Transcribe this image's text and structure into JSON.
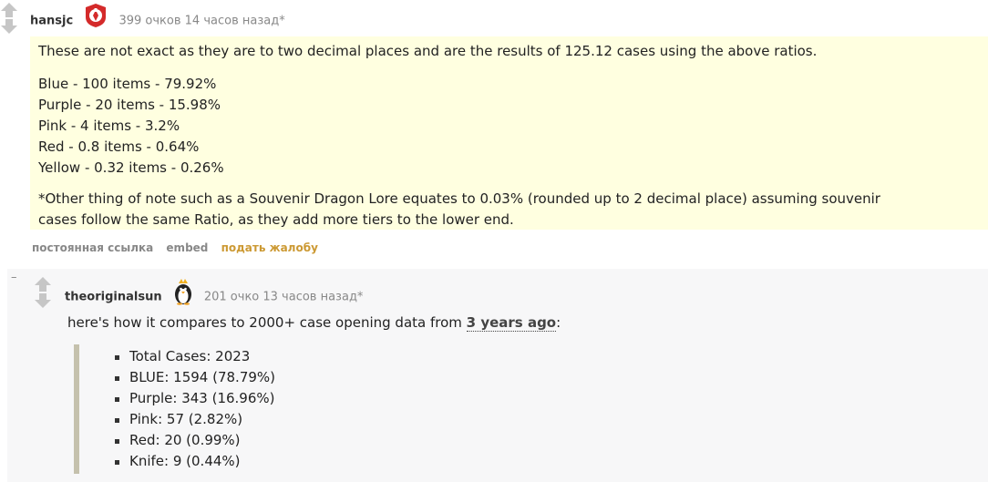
{
  "comment": {
    "author": "hansjc",
    "flair_icon": "gambit-logo-icon",
    "score_time": "399 очков 14 часов назад*",
    "paragraphs": [
      "These are not exact as they are to two decimal places and are the results of 125.12 cases using the above ratios."
    ],
    "lines": [
      "Blue - 100 items - 79.92%",
      "Purple - 20 items - 15.98%",
      "Pink - 4 items - 3.2%",
      "Red - 0.8 items - 0.64%",
      "Yellow - 0.32 items - 0.26%"
    ],
    "note_line1": "*Other thing of note such as a Souvenir Dragon Lore equates to 0.03% (rounded up to 2 decimal place) assuming souvenir",
    "note_line2": "cases follow the same Ratio, as they add more tiers to the lower end.",
    "highlight_color": "#ffffe0",
    "buttons": {
      "permalink": "постоянная ссылка",
      "embed": "embed",
      "report": "подать жалобу"
    }
  },
  "reply": {
    "collapse": "–",
    "author": "theoriginalsun",
    "flair_icon": "penguin-icon",
    "score_time": "201 очко 13 часов назад*",
    "text_before": "here's how it compares to 2000+ case opening data from ",
    "link_text": "3 years ago",
    "text_after": ":",
    "list": [
      "Total Cases: 2023",
      "BLUE: 1594 (78.79%)",
      "Purple: 343 (16.96%)",
      "Pink: 57 (2.82%)",
      "Red: 20 (0.99%)",
      "Knife: 9 (0.44%)"
    ]
  }
}
